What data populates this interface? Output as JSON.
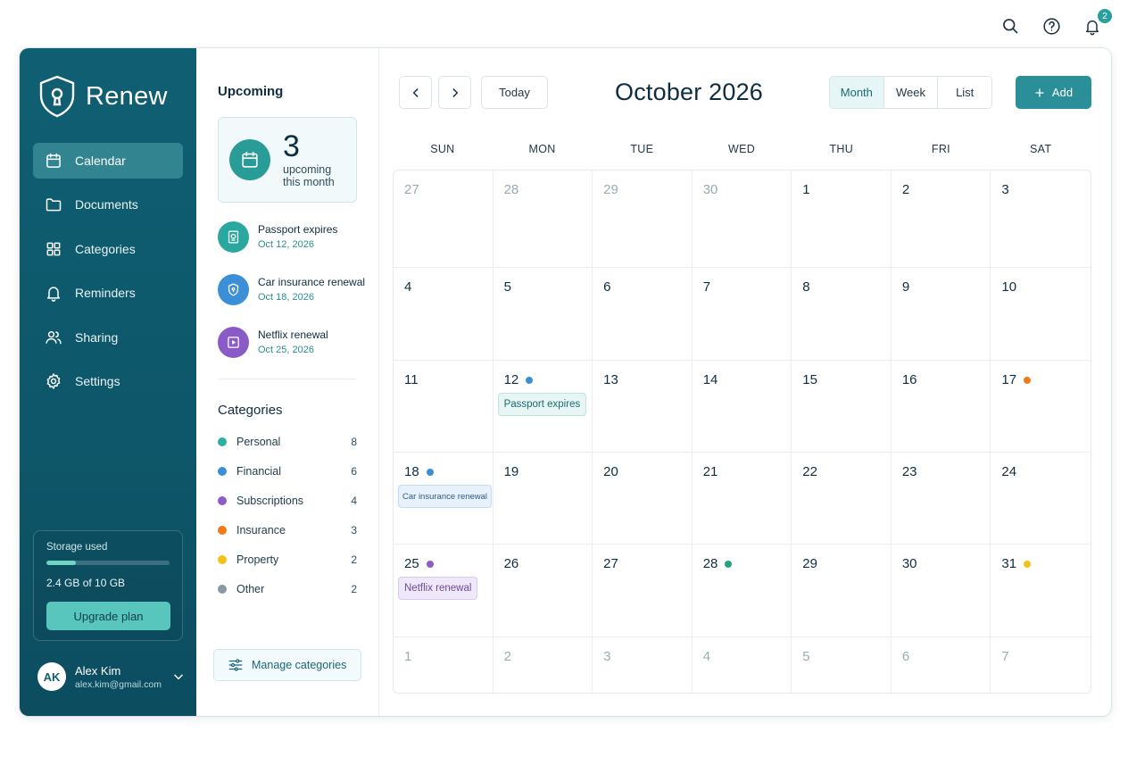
{
  "topbar": {
    "notification_count": "2"
  },
  "brand": {
    "name": "Renew"
  },
  "sidebar": {
    "items": [
      {
        "label": "Calendar",
        "icon": "calendar-icon",
        "active": true
      },
      {
        "label": "Documents",
        "icon": "folder-icon"
      },
      {
        "label": "Categories",
        "icon": "grid-icon"
      },
      {
        "label": "Reminders",
        "icon": "bell-icon"
      },
      {
        "label": "Sharing",
        "icon": "users-icon"
      },
      {
        "label": "Settings",
        "icon": "gear-icon"
      }
    ],
    "storage": {
      "label": "Storage used",
      "text": "2.4 GB of 10 GB",
      "used_fraction": 0.24,
      "upgrade_label": "Upgrade plan"
    },
    "user": {
      "initials": "AK",
      "name": "Alex Kim",
      "email": "alex.kim@gmail.com"
    }
  },
  "panel": {
    "upcoming_title": "Upcoming",
    "card": {
      "count": "3",
      "subtitle": "upcoming this month"
    },
    "items": [
      {
        "name": "Passport expires",
        "date": "Oct 12, 2026",
        "icon": "passport-icon",
        "color": "#2aa89f"
      },
      {
        "name": "Car insurance renewal",
        "date": "Oct 18, 2026",
        "icon": "shield-icon",
        "color": "#3a8fd6"
      },
      {
        "name": "Netflix renewal",
        "date": "Oct 25, 2026",
        "icon": "play-icon",
        "color": "#8a5bc7"
      }
    ],
    "categories_title": "Categories",
    "categories": [
      {
        "name": "Personal",
        "count": "8",
        "color": "#2bb0a3"
      },
      {
        "name": "Financial",
        "count": "6",
        "color": "#3b8fd8"
      },
      {
        "name": "Subscriptions",
        "count": "4",
        "color": "#8e5bc8"
      },
      {
        "name": "Insurance",
        "count": "3",
        "color": "#ee7a1a"
      },
      {
        "name": "Property",
        "count": "2",
        "color": "#f2c21b"
      },
      {
        "name": "Other",
        "count": "2",
        "color": "#8a98a3"
      }
    ],
    "manage_label": "Manage categories"
  },
  "calendar": {
    "today_label": "Today",
    "month_title": "October 2026",
    "views": [
      "Month",
      "Week",
      "List"
    ],
    "active_view": "Month",
    "add_label": "Add",
    "weekdays": [
      "SUN",
      "MON",
      "TUE",
      "WED",
      "THU",
      "FRI",
      "SAT"
    ],
    "days": [
      {
        "n": "27",
        "muted": true
      },
      {
        "n": "28",
        "muted": true
      },
      {
        "n": "29",
        "muted": true
      },
      {
        "n": "30",
        "muted": true
      },
      {
        "n": "1"
      },
      {
        "n": "2"
      },
      {
        "n": "3"
      },
      {
        "n": "4"
      },
      {
        "n": "5"
      },
      {
        "n": "6"
      },
      {
        "n": "7"
      },
      {
        "n": "8"
      },
      {
        "n": "9"
      },
      {
        "n": "10"
      },
      {
        "n": "11"
      },
      {
        "n": "12",
        "dot": "#3a8fd6",
        "event": {
          "label": "Passport expires",
          "bg": "#e7f6f4",
          "border": "#bfe3dd",
          "color": "#1b6d70"
        }
      },
      {
        "n": "13"
      },
      {
        "n": "14"
      },
      {
        "n": "15"
      },
      {
        "n": "16"
      },
      {
        "n": "17",
        "dot": "#ee7a1a"
      },
      {
        "n": "18",
        "dot": "#3a8fd6",
        "event": {
          "label": "Car insurance renewal",
          "bg": "#e6f1fb",
          "border": "#c3dbf2",
          "color": "#2d5d86"
        }
      },
      {
        "n": "19"
      },
      {
        "n": "20"
      },
      {
        "n": "21"
      },
      {
        "n": "22"
      },
      {
        "n": "23"
      },
      {
        "n": "24"
      },
      {
        "n": "25",
        "dot": "#8e5bc8",
        "event": {
          "label": "Netflix renewal",
          "bg": "#efe8f8",
          "border": "#d9cbee",
          "color": "#6d4a9c"
        }
      },
      {
        "n": "26"
      },
      {
        "n": "27"
      },
      {
        "n": "28",
        "dot": "#22a57a"
      },
      {
        "n": "29"
      },
      {
        "n": "30"
      },
      {
        "n": "31",
        "dot": "#f2c21b"
      },
      {
        "n": "1",
        "muted": true
      },
      {
        "n": "2",
        "muted": true
      },
      {
        "n": "3",
        "muted": true
      },
      {
        "n": "4",
        "muted": true
      },
      {
        "n": "5",
        "muted": true
      },
      {
        "n": "6",
        "muted": true
      },
      {
        "n": "7",
        "muted": true
      }
    ]
  }
}
